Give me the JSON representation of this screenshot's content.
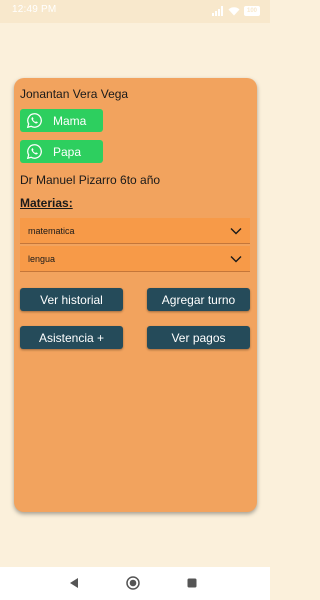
{
  "status_bar": {
    "time": "12:49 PM",
    "battery": "100"
  },
  "student": {
    "name": "Jonantan Vera Vega",
    "contacts": [
      {
        "label": "Mama",
        "icon": "whatsapp-icon"
      },
      {
        "label": "Papa",
        "icon": "whatsapp-icon"
      }
    ],
    "school": "Dr Manuel Pizarro 6to año"
  },
  "materias": {
    "heading": "Materias:",
    "dropdowns": [
      {
        "value": "matematica",
        "icon": "chevron-down-icon"
      },
      {
        "value": "lengua",
        "icon": "chevron-down-icon"
      }
    ]
  },
  "actions": {
    "ver_historial": "Ver historial",
    "agregar_turno": "Agregar turno",
    "asistencia": "Asistencia +",
    "ver_pagos": "Ver pagos"
  },
  "nav": {
    "back_icon": "back-triangle-icon",
    "home_icon": "home-circle-icon",
    "recents_icon": "recents-square-icon"
  },
  "colors": {
    "background": "#fbf0db",
    "card": "#f2a35e",
    "dropdown": "#f79a48",
    "whatsapp_green": "#2dcf5f",
    "action_button": "#254b5a"
  }
}
